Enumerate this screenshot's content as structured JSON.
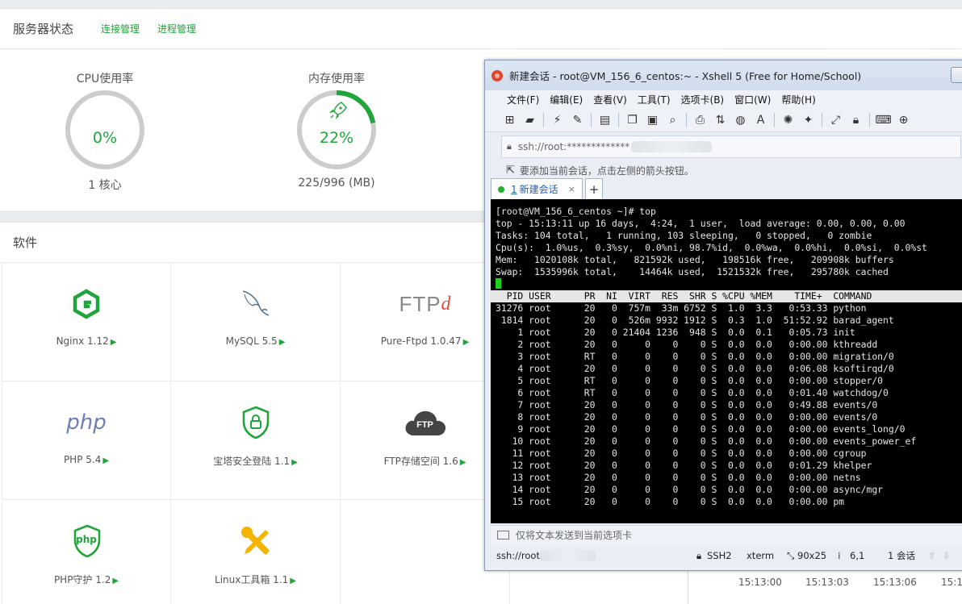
{
  "status": {
    "title": "服务器状态",
    "links": [
      "连接管理",
      "进程管理"
    ],
    "cpu": {
      "label": "CPU使用率",
      "percent_text": "0%",
      "value": 0,
      "sub": "1 核心"
    },
    "mem": {
      "label": "内存使用率",
      "percent_text": "22%",
      "value": 22,
      "sub": "225/996 (MB)"
    }
  },
  "software": {
    "title": "软件",
    "items": [
      {
        "name": "Nginx 1.12",
        "icon": "nginx-icon"
      },
      {
        "name": "MySQL 5.5",
        "icon": "mysql-dolphin-icon"
      },
      {
        "name": "Pure-Ftpd 1.0.47",
        "icon": "ftpd-icon"
      },
      {
        "name": "PHP 5.4",
        "icon": "php-icon"
      },
      {
        "name": "宝塔安全登陆 1.1",
        "icon": "shield-lock-icon"
      },
      {
        "name": "FTP存储空间 1.6",
        "icon": "ftp-cloud-icon"
      },
      {
        "name": "PHP守护 1.2",
        "icon": "php-shield-icon"
      },
      {
        "name": "Linux工具箱 1.1",
        "icon": "wrench-screwdriver-icon"
      }
    ],
    "ftp_icon_text": "FTP",
    "ftpd_icon_text": "FTP",
    "ftpd_icon_suffix": "d",
    "php_icon_text": "php",
    "php_shield_text": "php"
  },
  "chart_times": [
    "15:13:00",
    "15:13:03",
    "15:13:06",
    "15:1"
  ],
  "colors": {
    "accent": "#20a53a",
    "gauge_track": "#cccccc",
    "terminal_bg": "#000000"
  },
  "xshell": {
    "title": "新建会话 - root@VM_156_6_centos:~ - Xshell 5 (Free for Home/School)",
    "menu": [
      "文件(F)",
      "编辑(E)",
      "查看(V)",
      "工具(T)",
      "选项卡(B)",
      "窗口(W)",
      "帮助(H)"
    ],
    "address": "ssh://root:*************",
    "hint": "要添加当前会话，点击左侧的箭头按钮。",
    "tab": {
      "number": "1",
      "label": "新建会话",
      "close": "×"
    },
    "tab_add": "+",
    "input_hint": "仅将文本发送到当前选项卡",
    "status": {
      "conn": "ssh://root",
      "proto": "SSH2",
      "term": "xterm",
      "size": "90x25",
      "pos": "6,1",
      "sessions": "1 会话"
    }
  },
  "terminal": {
    "prompt": "[root@VM_156_6_centos ~]# top",
    "summary": [
      "top - 15:13:11 up 16 days,  4:24,  1 user,  load average: 0.00, 0.00, 0.00",
      "Tasks: 104 total,   1 running, 103 sleeping,   0 stopped,   0 zombie",
      "Cpu(s):  1.0%us,  0.3%sy,  0.0%ni, 98.7%id,  0.0%wa,  0.0%hi,  0.0%si,  0.0%st",
      "Mem:   1020108k total,   821592k used,   198516k free,   209908k buffers",
      "Swap:  1535996k total,    14464k used,  1521532k free,   295780k cached"
    ],
    "header": "  PID USER      PR  NI  VIRT  RES  SHR S %CPU %MEM    TIME+  COMMAND",
    "rows": [
      "31276 root      20   0  757m  33m 6752 S  1.0  3.3   0:53.33 python",
      " 1814 root      20   0  526m 9932 1912 S  0.3  1.0  51:52.92 barad_agent",
      "    1 root      20   0 21404 1236  948 S  0.0  0.1   0:05.73 init",
      "    2 root      20   0     0    0    0 S  0.0  0.0   0:00.00 kthreadd",
      "    3 root      RT   0     0    0    0 S  0.0  0.0   0:00.00 migration/0",
      "    4 root      20   0     0    0    0 S  0.0  0.0   0:06.08 ksoftirqd/0",
      "    5 root      RT   0     0    0    0 S  0.0  0.0   0:00.00 stopper/0",
      "    6 root      RT   0     0    0    0 S  0.0  0.0   0:01.40 watchdog/0",
      "    7 root      20   0     0    0    0 S  0.0  0.0   0:49.88 events/0",
      "    8 root      20   0     0    0    0 S  0.0  0.0   0:00.00 events/0",
      "    9 root      20   0     0    0    0 S  0.0  0.0   0:00.00 events_long/0",
      "   10 root      20   0     0    0    0 S  0.0  0.0   0:00.00 events_power_ef",
      "   11 root      20   0     0    0    0 S  0.0  0.0   0:00.00 cgroup",
      "   12 root      20   0     0    0    0 S  0.0  0.0   0:01.29 khelper",
      "   13 root      20   0     0    0    0 S  0.0  0.0   0:00.00 netns",
      "   14 root      20   0     0    0    0 S  0.0  0.0   0:00.00 async/mgr",
      "   15 root      20   0     0    0    0 S  0.0  0.0   0:00.00 pm"
    ]
  }
}
